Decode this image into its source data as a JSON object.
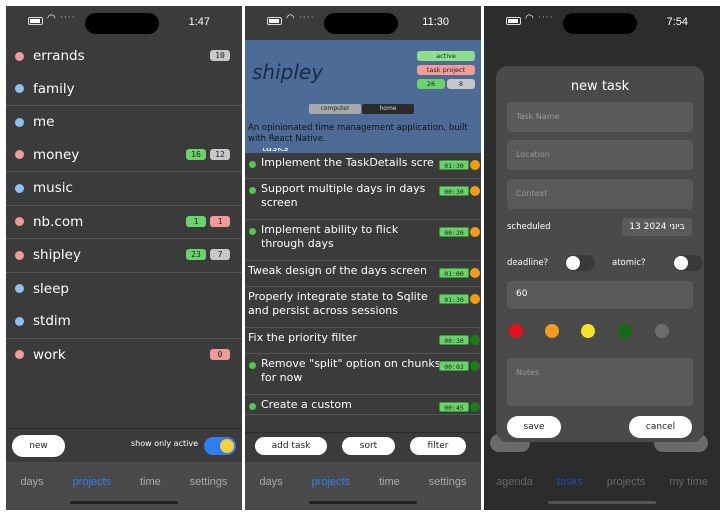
{
  "screen1": {
    "time": "1:47",
    "projects": [
      {
        "name": "errands",
        "color": "#f09a9a",
        "badges": [
          {
            "v": "10",
            "c": "gray"
          }
        ]
      },
      {
        "name": "family",
        "color": "#8fc0ef",
        "badges": []
      },
      {
        "name": "me",
        "color": "#8fc0ef",
        "badges": []
      },
      {
        "name": "money",
        "color": "#f09a9a",
        "badges": [
          {
            "v": "16",
            "c": "green"
          },
          {
            "v": "12",
            "c": "gray"
          }
        ]
      },
      {
        "name": "music",
        "color": "#8fc0ef",
        "badges": []
      },
      {
        "name": "nb.com",
        "color": "#f09a9a",
        "badges": [
          {
            "v": "1",
            "c": "green"
          },
          {
            "v": "1",
            "c": "pink"
          }
        ]
      },
      {
        "name": "shipley",
        "color": "#f09a9a",
        "badges": [
          {
            "v": "23",
            "c": "green"
          },
          {
            "v": "7",
            "c": "gray"
          }
        ]
      },
      {
        "name": "sleep",
        "color": "#8fc0ef",
        "badges": []
      },
      {
        "name": "stdim",
        "color": "#8fc0ef",
        "badges": []
      },
      {
        "name": "work",
        "color": "#f09a9a",
        "badges": [
          {
            "v": "0",
            "c": "pink"
          }
        ]
      }
    ],
    "new_label": "new",
    "show_only_active_label": "show only active",
    "tabs": [
      "days",
      "projects",
      "time",
      "settings"
    ],
    "active_tab": "projects"
  },
  "screen2": {
    "time": "11:30",
    "project_name": "shipley",
    "chip_active": "active",
    "chip_task_project": "task project",
    "count_green": "26",
    "count_gray": "8",
    "seg_computer": "computer",
    "seg_home": "home",
    "description": "An opinionated time management application, built with React Native.",
    "partial_text": "tasks",
    "tasks": [
      {
        "text": "Implement the TaskDetails scre",
        "dot": true,
        "dur": "01:30",
        "prio": "#f39c12"
      },
      {
        "text": "Support multiple days in days screen",
        "dot": true,
        "dur": "00:30",
        "prio": "#f39c12"
      },
      {
        "text": "Implement ability to flick through days",
        "dot": true,
        "dur": "00:20",
        "prio": "#f39c12"
      },
      {
        "text": "Tweak design of the days screen",
        "dot": false,
        "dur": "01:00",
        "prio": "#f39c12"
      },
      {
        "text": "Properly integrate state to Sqlite and persist across sessions",
        "dot": false,
        "dur": "01:30",
        "prio": "#f39c12"
      },
      {
        "text": "Fix the priority filter",
        "dot": false,
        "dur": "00:30",
        "prio": "#1f7a1f"
      },
      {
        "text": "Remove \"split\" option on chunks for now",
        "dot": true,
        "dur": "00:02",
        "prio": "#1f7a1f"
      },
      {
        "text": "Create a custom",
        "dot": true,
        "dur": "00:45",
        "prio": "#1f7a1f"
      }
    ],
    "add_task_label": "add task",
    "sort_label": "sort",
    "filter_label": "filter",
    "tabs": [
      "days",
      "projects",
      "time",
      "settings"
    ],
    "active_tab": "projects"
  },
  "screen3": {
    "time": "7:54",
    "title": "new task",
    "task_name_placeholder": "Task Name",
    "location_placeholder": "Location",
    "context_placeholder": "Context",
    "scheduled_label": "scheduled",
    "scheduled_date": "13 ביוני 2024",
    "deadline_label": "deadline?",
    "atomic_label": "atomic?",
    "duration_value": "60",
    "priority_colors": [
      "#e3101e",
      "#f39c21",
      "#f4e22c",
      "#136b14",
      "#6d6d6d"
    ],
    "notes_placeholder": "Notes",
    "save_label": "save",
    "cancel_label": "cancel",
    "tabs": [
      "agenda",
      "tasks",
      "projects",
      "my time"
    ],
    "active_tab": "tasks"
  }
}
